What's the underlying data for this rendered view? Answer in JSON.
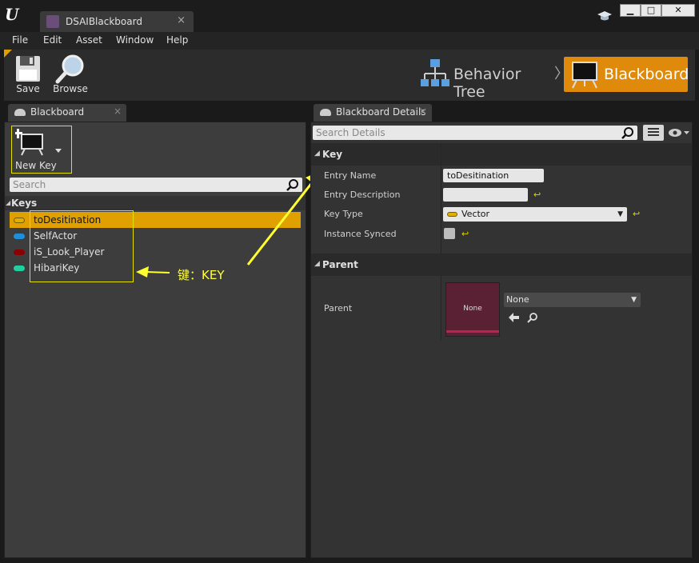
{
  "window": {
    "tab_title": "DSAIBlackboard",
    "tab_close": "×",
    "minimize": "▁",
    "maximize": "□",
    "close": "✕"
  },
  "menu": [
    "File",
    "Edit",
    "Asset",
    "Window",
    "Help"
  ],
  "toolbar": {
    "save_label": "Save",
    "browse_label": "Browse",
    "mode_behavior_tree": "Behavior Tree",
    "mode_separator": "〉",
    "mode_blackboard": "Blackboard",
    "accent_color": "#e08a0c"
  },
  "blackboard_panel": {
    "tab_label": "Blackboard",
    "tab_close": "×",
    "new_key_label": "New Key",
    "search_placeholder": "Search",
    "keys_header": "Keys",
    "keys": [
      {
        "label": "toDesitination",
        "color": "#e0b000",
        "selected": true
      },
      {
        "label": "SelfActor",
        "color": "#1e8fd8",
        "selected": false
      },
      {
        "label": "iS_Look_Player",
        "color": "#8a0000",
        "selected": false
      },
      {
        "label": "HibariKey",
        "color": "#20d0a0",
        "selected": false
      }
    ],
    "annotation": "键：KEY",
    "annotation_color": "#ffff40"
  },
  "details_panel": {
    "tab_label": "Blackboard Details",
    "tab_close": "×",
    "search_placeholder": "Search Details",
    "key_section": "Key",
    "entry_name_label": "Entry Name",
    "entry_name_value": "toDesitination",
    "entry_description_label": "Entry Description",
    "entry_description_value": "",
    "key_type_label": "Key Type",
    "key_type_value": "Vector",
    "instance_synced_label": "Instance Synced",
    "parent_section": "Parent",
    "parent_label": "Parent",
    "parent_thumbnail_text": "None",
    "parent_value": "None",
    "reset_glyph": "↩"
  }
}
